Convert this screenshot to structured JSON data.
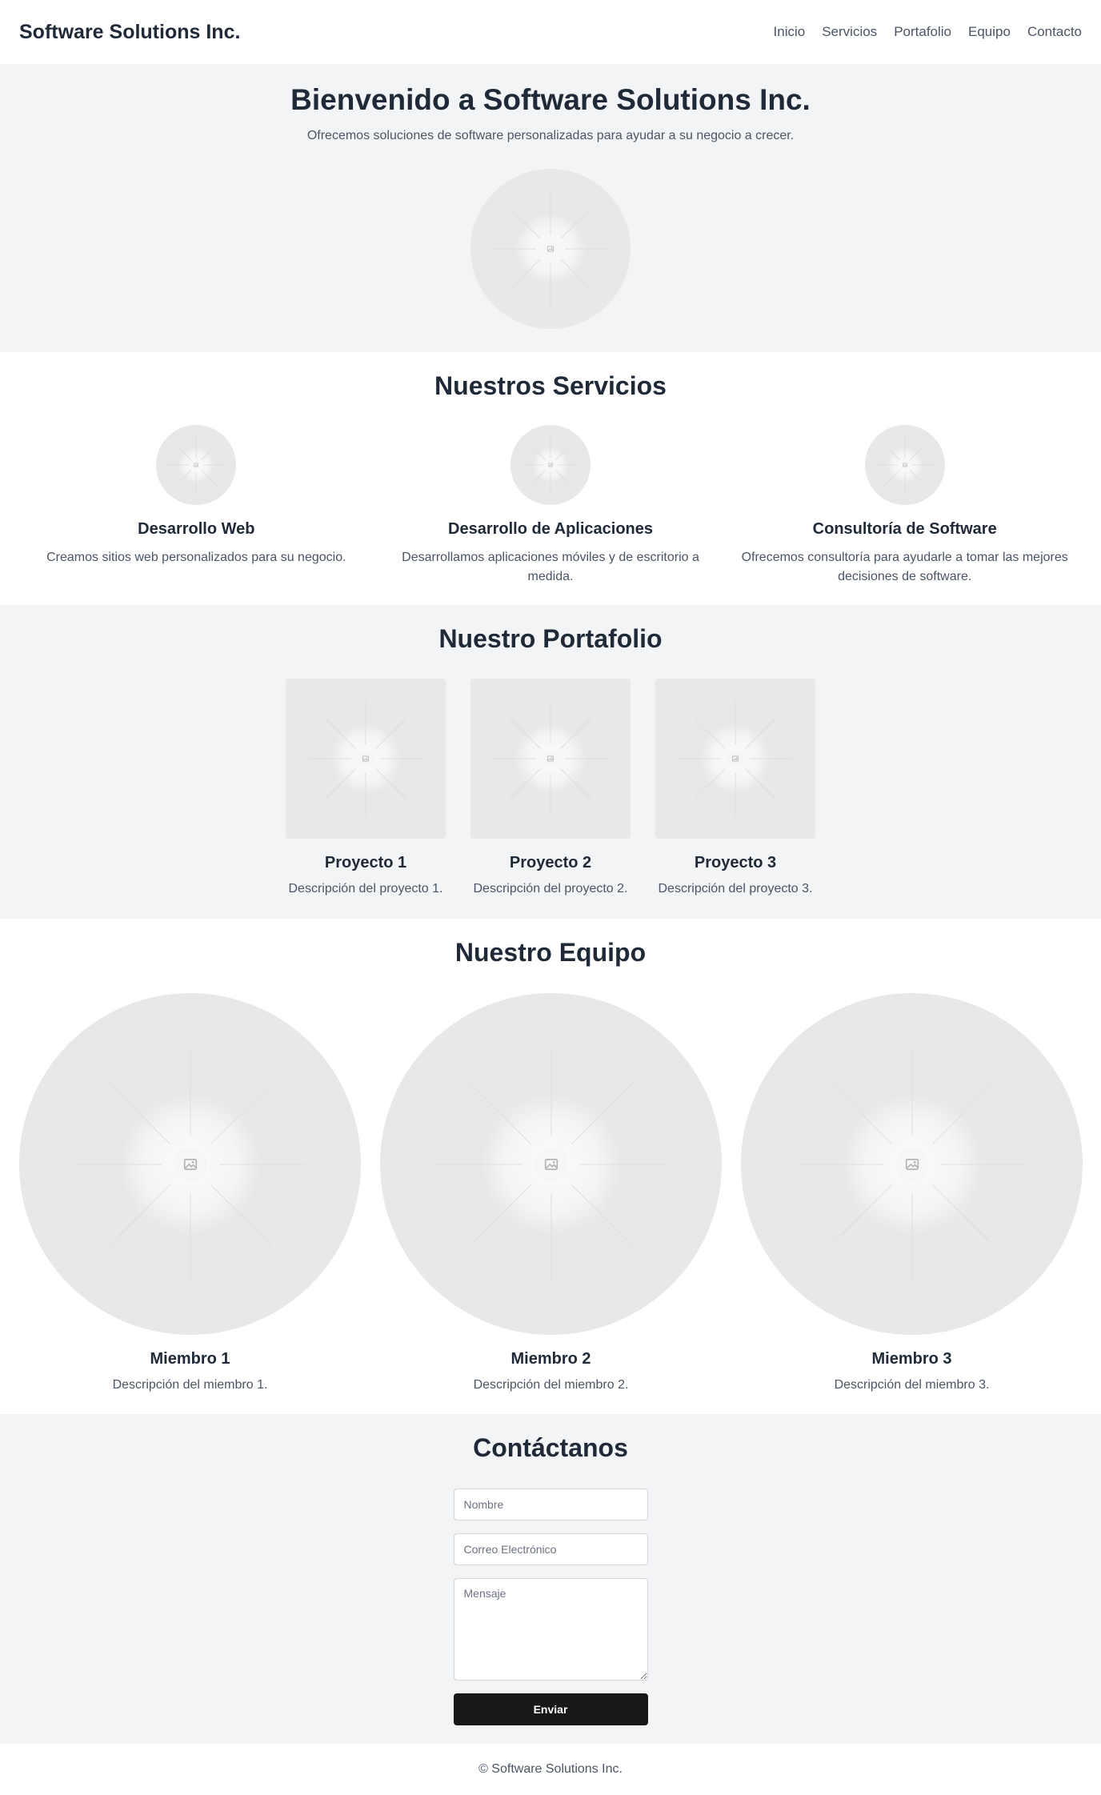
{
  "header": {
    "brand": "Software Solutions Inc.",
    "nav": [
      "Inicio",
      "Servicios",
      "Portafolio",
      "Equipo",
      "Contacto"
    ]
  },
  "hero": {
    "title": "Bienvenido a Software Solutions Inc.",
    "subtitle": "Ofrecemos soluciones de software personalizadas para ayudar a su negocio a crecer."
  },
  "services": {
    "title": "Nuestros Servicios",
    "items": [
      {
        "title": "Desarrollo Web",
        "text": "Creamos sitios web personalizados para su negocio."
      },
      {
        "title": "Desarrollo de Aplicaciones",
        "text": "Desarrollamos aplicaciones móviles y de escritorio a medida."
      },
      {
        "title": "Consultoría de Software",
        "text": "Ofrecemos consultoría para ayudarle a tomar las mejores decisiones de software."
      }
    ]
  },
  "portfolio": {
    "title": "Nuestro Portafolio",
    "items": [
      {
        "title": "Proyecto 1",
        "text": "Descripción del proyecto 1."
      },
      {
        "title": "Proyecto 2",
        "text": "Descripción del proyecto 2."
      },
      {
        "title": "Proyecto 3",
        "text": "Descripción del proyecto 3."
      }
    ]
  },
  "team": {
    "title": "Nuestro Equipo",
    "items": [
      {
        "title": "Miembro 1",
        "text": "Descripción del miembro 1."
      },
      {
        "title": "Miembro 2",
        "text": "Descripción del miembro 2."
      },
      {
        "title": "Miembro 3",
        "text": "Descripción del miembro 3."
      }
    ]
  },
  "contact": {
    "title": "Contáctanos",
    "name_placeholder": "Nombre",
    "email_placeholder": "Correo Electrónico",
    "message_placeholder": "Mensaje",
    "submit_label": "Enviar"
  },
  "footer": {
    "text": "© Software Solutions Inc."
  },
  "colors": {
    "section_alt_bg": "#f3f4f6",
    "placeholder_bg": "#e8e8e8",
    "button_bg": "#18181b",
    "heading": "#1f2937",
    "body_text": "#4b5563"
  },
  "icons": {
    "placeholder": "image-placeholder-icon"
  }
}
